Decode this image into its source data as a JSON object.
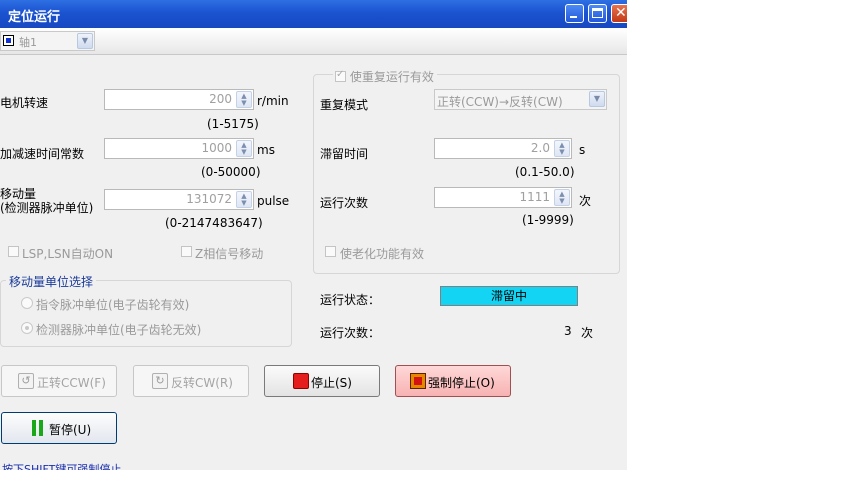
{
  "window": {
    "title": "定位运行"
  },
  "axis": {
    "selected": "轴1"
  },
  "motor_speed": {
    "label": "电机转速",
    "value": "200",
    "unit": "r/min",
    "range": "(1-5175)"
  },
  "accel_time": {
    "label": "加减速时间常数",
    "value": "1000",
    "unit": "ms",
    "range": "(0-50000)"
  },
  "travel": {
    "label_line1": "移动量",
    "label_line2": "(检测器脉冲单位)",
    "value": "131072",
    "unit": "pulse",
    "range": "(0-2147483647)"
  },
  "checks": {
    "lsp_lsn": "LSP,LSN自动ON",
    "z_phase": "Z相信号移动",
    "aging": "使老化功能有效"
  },
  "unit_group": {
    "title": "移动量单位选择",
    "option1": "指令脉冲单位(电子齿轮有效)",
    "option2": "检测器脉冲单位(电子齿轮无效)"
  },
  "repeat": {
    "enable_label": "使重复运行有效",
    "pattern_label": "重复模式",
    "pattern_value": "正转(CCW)→反转(CW)",
    "dwell_label": "滞留时间",
    "dwell_value": "2.0",
    "dwell_unit": "s",
    "dwell_range": "(0.1-50.0)",
    "count_label": "运行次数",
    "count_value": "1111",
    "count_unit": "次",
    "count_range": "(1-9999)"
  },
  "status": {
    "state_label": "运行状态：",
    "state_value": "滞留中",
    "count_label": "运行次数：",
    "count_value": "3",
    "count_unit": "次"
  },
  "buttons": {
    "forward": "正转CCW(F)",
    "reverse": "反转CW(R)",
    "stop": "停止(S)",
    "force_stop": "强制停止(O)",
    "pause": "暂停(U)"
  },
  "footer": {
    "note": "按下SHIFT键可强制停止"
  },
  "colors": {
    "status_bg": "#14d4f4",
    "title_bar": "#1b53d0",
    "stop": "#e51d1d"
  }
}
